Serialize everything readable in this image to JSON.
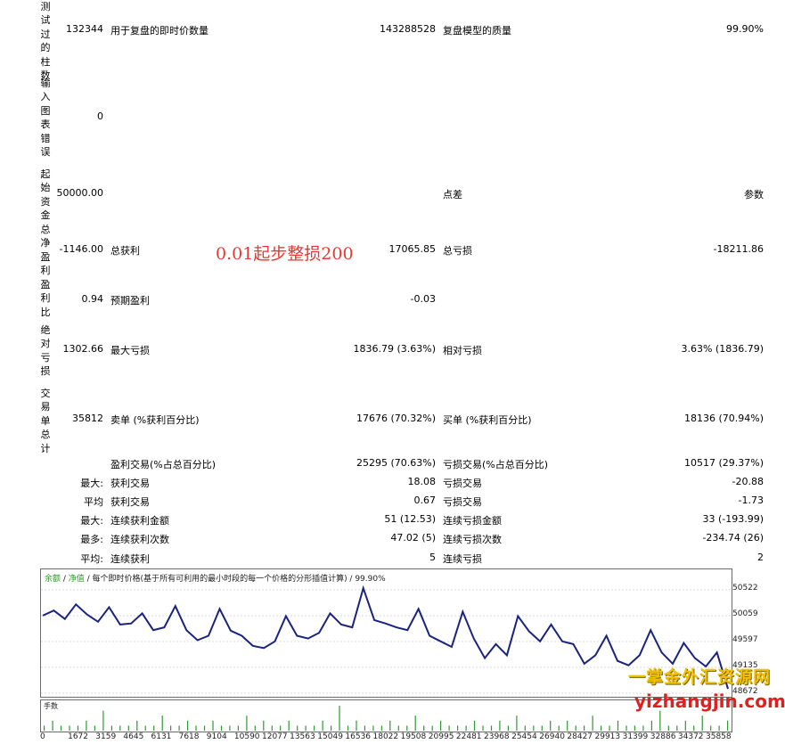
{
  "report": {
    "bars_tested": {
      "label": "测试过的柱数",
      "value": "132344"
    },
    "ticks_modelled": {
      "label": "用于复盘的即时价数量",
      "value": "143288528"
    },
    "model_quality": {
      "label": "复盘模型的质量",
      "value": "99.90%"
    },
    "mismatched_errors": {
      "label": "输入图表错误",
      "value": "0"
    },
    "initial_deposit": {
      "label": "起始资金",
      "value": "50000.00"
    },
    "spread": {
      "label": "点差",
      "value": "参数"
    },
    "total_net_profit": {
      "label": "总净盈利",
      "value": "-1146.00"
    },
    "gross_profit": {
      "label": "总获利",
      "value": "17065.85"
    },
    "gross_loss": {
      "label": "总亏损",
      "value": "-18211.86"
    },
    "profit_factor": {
      "label": "盈利比",
      "value": "0.94"
    },
    "expected_payoff": {
      "label": "预期盈利",
      "value": "-0.03"
    },
    "abs_drawdown": {
      "label": "绝对亏损",
      "value": "1302.66"
    },
    "max_drawdown": {
      "label": "最大亏损",
      "value": "1836.79 (3.63%)"
    },
    "rel_drawdown": {
      "label": "相对亏损",
      "value": "3.63% (1836.79)"
    },
    "total_trades": {
      "label": "交易单总计",
      "value": "35812"
    },
    "short_positions": {
      "label": "卖单 (%获利百分比)",
      "value": "17676 (70.32%)"
    },
    "long_positions": {
      "label": "买单 (%获利百分比)",
      "value": "18136 (70.94%)"
    },
    "profit_trades": {
      "label": "盈利交易(%占总百分比)",
      "value": "25295 (70.63%)"
    },
    "loss_trades": {
      "label": "亏损交易(%占总百分比)",
      "value": "10517 (29.37%)"
    },
    "largest_prefix": "最大:",
    "largest_profit": {
      "label": "获利交易",
      "value": "18.08"
    },
    "largest_loss": {
      "label": "亏损交易",
      "value": "-20.88"
    },
    "average_prefix": "平均",
    "average_profit": {
      "label": "获利交易",
      "value": "0.67"
    },
    "average_loss": {
      "label": "亏损交易",
      "value": "-1.73"
    },
    "max_cons_prefix": "最大:",
    "max_cons_wins": {
      "label": "连续获利金额",
      "value": "51 (12.53)"
    },
    "max_cons_losses": {
      "label": "连续亏损金额",
      "value": "33 (-193.99)"
    },
    "maximal_prefix": "最多:",
    "maximal_cons_profit": {
      "label": "连续获利次数",
      "value": "47.02 (5)"
    },
    "maximal_cons_loss": {
      "label": "连续亏损次数",
      "value": "-234.74 (26)"
    },
    "avg_cons_prefix": "平均:",
    "avg_cons_wins": {
      "label": "连续获利",
      "value": "5"
    },
    "avg_cons_losses": {
      "label": "连续亏损",
      "value": "2"
    }
  },
  "overlay_text": "0.01起步整损200",
  "chart_header": {
    "balance": "余额",
    "sep1": " / ",
    "equity": "净值",
    "rest": " / 每个即时价格(基于所有可利用的最小时段的每一个价格的分形插值计算) / 99.90%"
  },
  "volume_label": "手数",
  "watermark": {
    "line1": "一掌金外汇资源网",
    "line2": "yizhangjin.com"
  },
  "chart_data": {
    "type": "line",
    "series": [
      {
        "values": [
          50060,
          50150,
          50000,
          50260,
          50080,
          49950,
          50210,
          49900,
          49920,
          50100,
          49800,
          49850,
          50230,
          49800,
          49620,
          49700,
          50180,
          49790,
          49700,
          49520,
          49480,
          49600,
          50050,
          49700,
          49650,
          49750,
          50100,
          49900,
          49850,
          50550,
          49980,
          49920,
          49850,
          49800,
          50180,
          49700,
          49600,
          49500,
          50130,
          49650,
          49300,
          49550,
          49350,
          50050,
          49780,
          49600,
          49900,
          49600,
          49550,
          49200,
          49350,
          49700,
          49250,
          49170,
          49350,
          49800,
          49400,
          49200,
          49570,
          49300,
          49150,
          49400,
          48750
        ]
      }
    ],
    "x_ticks": [
      "0",
      "1672",
      "3159",
      "4645",
      "6131",
      "7618",
      "9104",
      "10590",
      "12077",
      "13563",
      "15049",
      "16536",
      "18022",
      "19508",
      "20995",
      "22481",
      "23968",
      "25454",
      "26940",
      "28427",
      "29913",
      "31399",
      "32886",
      "34372",
      "35858"
    ],
    "y_ticks": [
      "50522",
      "50059",
      "49597",
      "49135",
      "48672"
    ],
    "ylim": [
      48672,
      50600
    ],
    "volume": [
      1,
      2,
      1,
      1,
      1,
      2,
      1,
      4,
      1,
      1,
      1,
      2,
      1,
      1,
      3,
      1,
      1,
      2,
      1,
      1,
      2,
      1,
      1,
      1,
      3,
      1,
      2,
      1,
      1,
      2,
      1,
      1,
      1,
      2,
      1,
      5,
      1,
      2,
      1,
      1,
      1,
      2,
      1,
      1,
      3,
      1,
      1,
      2,
      1,
      1,
      1,
      2,
      1,
      1,
      2,
      1,
      3,
      1,
      1,
      1,
      2,
      1,
      2,
      1,
      1,
      3,
      1,
      1,
      2,
      1,
      1,
      1,
      2,
      4,
      1,
      1,
      2,
      1,
      3,
      1,
      1,
      2
    ]
  }
}
